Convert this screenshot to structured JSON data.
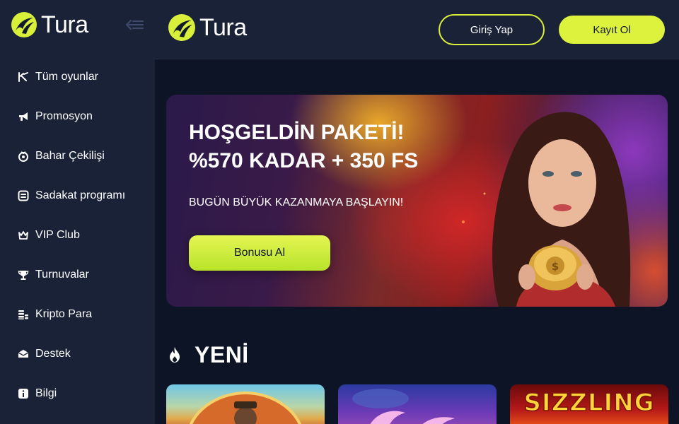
{
  "brand": {
    "name": "Tura",
    "accent": "#d8f03a"
  },
  "sidebar": {
    "items": [
      {
        "label": "Tüm oyunlar",
        "icon": "all-games-icon"
      },
      {
        "label": "Promosyon",
        "icon": "megaphone-icon"
      },
      {
        "label": "Bahar Çekilişi",
        "icon": "lottery-icon"
      },
      {
        "label": "Sadakat programı",
        "icon": "loyalty-icon"
      },
      {
        "label": "VIP Club",
        "icon": "crown-icon"
      },
      {
        "label": "Turnuvalar",
        "icon": "trophy-icon"
      },
      {
        "label": "Kripto Para",
        "icon": "crypto-coins-icon"
      },
      {
        "label": "Destek",
        "icon": "support-chat-icon"
      },
      {
        "label": "Bilgi",
        "icon": "info-icon"
      }
    ]
  },
  "header": {
    "login_label": "Giriş Yap",
    "register_label": "Kayıt Ol"
  },
  "banner": {
    "title_line1": "HOŞGELDİN PAKETİ!",
    "title_line2": "%570 KADAR + 350 FS",
    "subtitle": "BUGÜN BÜYÜK KAZANMAYA BAŞLAYIN!",
    "cta_label": "Bonusu Al"
  },
  "new_section": {
    "title": "YENİ",
    "icon": "flame-icon",
    "games": [
      {
        "name": ""
      },
      {
        "name": ""
      },
      {
        "name": "SIZZLING"
      }
    ]
  }
}
